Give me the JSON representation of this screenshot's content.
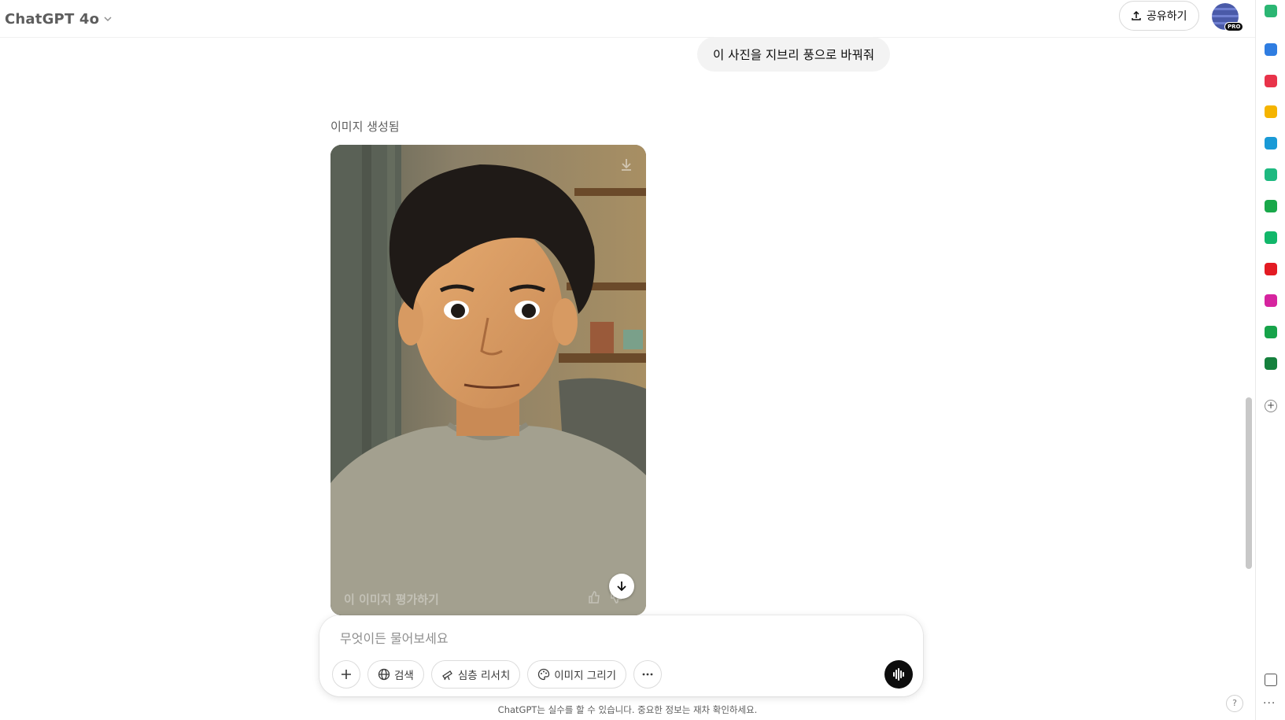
{
  "header": {
    "model_name": "ChatGPT 4o",
    "share_label": "공유하기",
    "pro_badge": "PRO"
  },
  "conversation": {
    "user_message": "이 사진을 지브리 풍으로 바꿔줘",
    "assistant_label": "이미지 생성됨",
    "rate_image_label": "이 이미지 평가하기"
  },
  "composer": {
    "placeholder": "무엇이든 물어보세요",
    "tools": {
      "search_label": "검색",
      "deep_research_label": "심층 리서치",
      "create_image_label": "이미지 그리기"
    }
  },
  "footer": {
    "disclaimer": "ChatGPT는 실수를 할 수 있습니다. 중요한 정보는 재차 확인하세요.",
    "help_label": "?"
  },
  "extensions": {
    "colors": [
      "#2bb673",
      "#2f7de1",
      "#e8334a",
      "#f5b400",
      "#1a9ad6",
      "#1eb980",
      "#19a84a",
      "#12b76a",
      "#e31b23",
      "#d6249f",
      "#17a34a",
      "#15803d"
    ]
  }
}
